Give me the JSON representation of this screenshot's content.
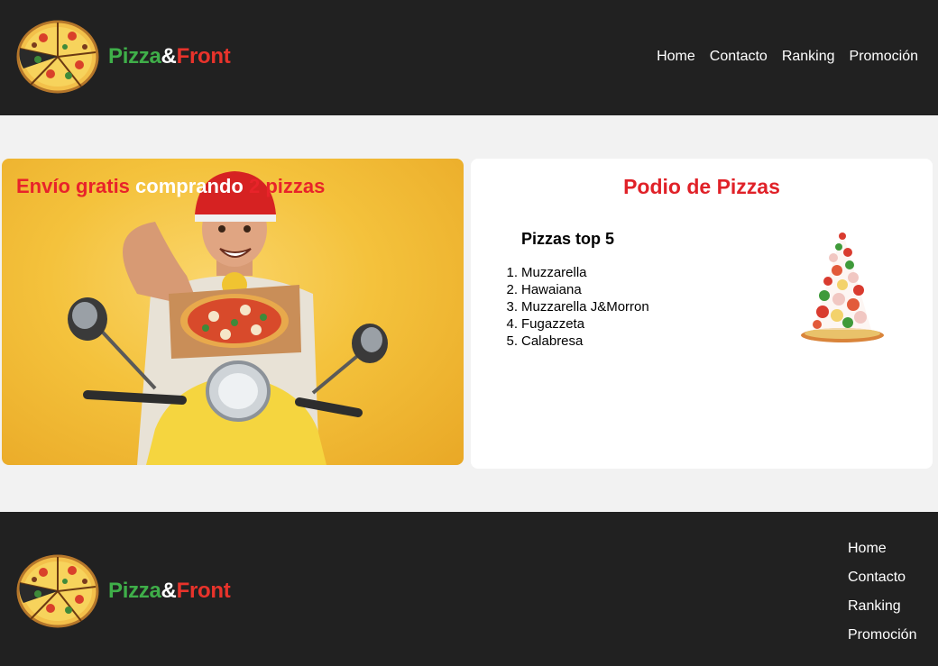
{
  "header": {
    "brand": {
      "part1": "Pizza",
      "part2": "&",
      "part3": "Front"
    },
    "nav": [
      {
        "label": "Home"
      },
      {
        "label": "Contacto"
      },
      {
        "label": "Ranking"
      },
      {
        "label": "Promoción"
      }
    ]
  },
  "promo": {
    "title_part1": "Envío gratis",
    "title_part2": "comprando",
    "title_part3": "2 pizzas"
  },
  "podium": {
    "title": "Podio de Pizzas",
    "list_title": "Pizzas top 5",
    "items": [
      "Muzzarella",
      "Hawaiana",
      "Muzzarella J&Morron",
      "Fugazzeta",
      "Calabresa"
    ]
  },
  "footer": {
    "brand": {
      "part1": "Pizza",
      "part2": "&",
      "part3": "Front"
    },
    "nav": [
      {
        "label": "Home"
      },
      {
        "label": "Contacto"
      },
      {
        "label": "Ranking"
      },
      {
        "label": "Promoción"
      }
    ]
  },
  "colors": {
    "dark_bg": "#212121",
    "page_bg": "#f2f2f2",
    "brand_green": "#3fae49",
    "brand_red": "#e8332b",
    "accent_red": "#e02128",
    "promo_yellow": "#f4c23c"
  }
}
